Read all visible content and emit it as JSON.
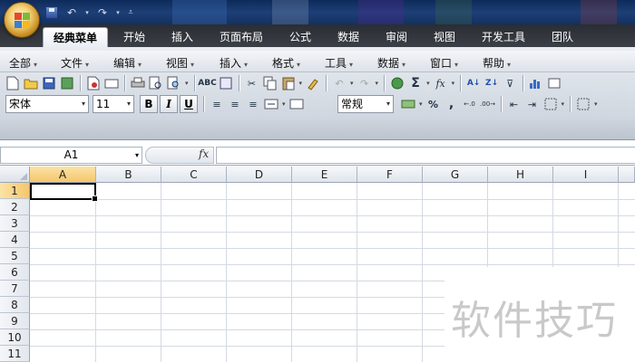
{
  "ribbon_tabs": [
    "经典菜单",
    "开始",
    "插入",
    "页面布局",
    "公式",
    "数据",
    "审阅",
    "视图",
    "开发工具",
    "团队"
  ],
  "active_tab": "经典菜单",
  "menus": [
    "全部",
    "文件",
    "编辑",
    "视图",
    "插入",
    "格式",
    "工具",
    "数据",
    "窗口",
    "帮助"
  ],
  "formatting": {
    "font_name": "宋体",
    "font_size": "11",
    "bold_label": "B",
    "italic_label": "I",
    "underline_label": "U",
    "number_format": "常规",
    "percent_label": "%",
    "comma_label": ",",
    "sigma_label": "Σ",
    "fx_label": "fx"
  },
  "formula_bar": {
    "name_box": "A1",
    "fx_label": "fx",
    "content": ""
  },
  "sheet": {
    "columns": [
      "A",
      "B",
      "C",
      "D",
      "E",
      "F",
      "G",
      "H",
      "I"
    ],
    "rows": [
      "1",
      "2",
      "3",
      "4",
      "5",
      "6",
      "7",
      "8",
      "9",
      "10",
      "11"
    ],
    "selected_column": "A",
    "selected_row": "1",
    "active_cell": "A1"
  },
  "watermark": "软件技巧",
  "colors": {
    "ribbon_tab_bg": "#2a2d33",
    "selected_header": "#f5c66c",
    "grid_line": "#d4dae3"
  }
}
